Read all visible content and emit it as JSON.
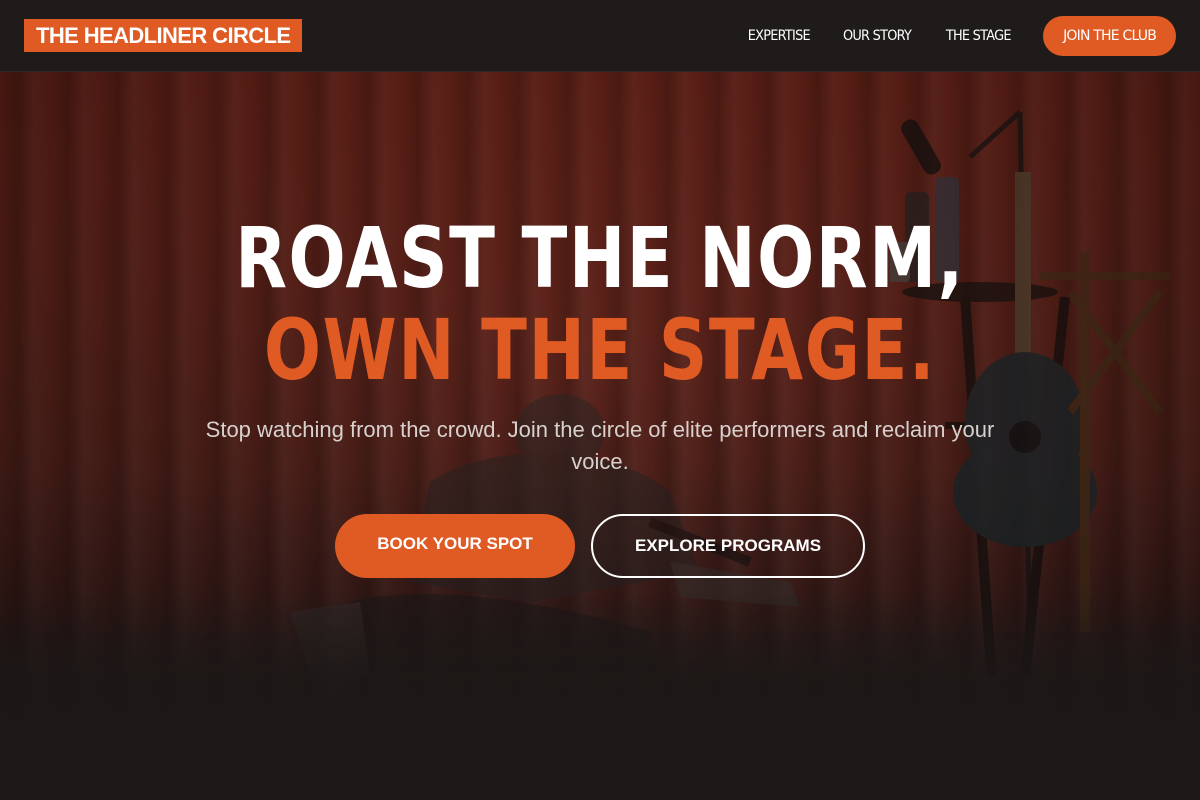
{
  "brand": {
    "name": "THE HEADLINER CIRCLE",
    "accent_color": "#e05a24"
  },
  "nav": {
    "links": [
      {
        "label": "EXPERTISE"
      },
      {
        "label": "OUR STORY"
      },
      {
        "label": "THE STAGE"
      }
    ],
    "join_label": "JOIN THE CLUB"
  },
  "hero": {
    "headline_line1": "ROAST THE NORM,",
    "headline_line2": "OWN THE STAGE.",
    "subtext": "Stop watching from the crowd. Join the circle of elite performers and reclaim your voice.",
    "primary_cta": "BOOK YOUR SPOT",
    "secondary_cta": "EXPLORE PROGRAMS",
    "background_image": "comedian on stage with red curtains, microphone stand, stool and guitar"
  },
  "colors": {
    "nav_bg": "#1e1b1a",
    "accent": "#e05a24",
    "text_light": "#ffffff"
  }
}
